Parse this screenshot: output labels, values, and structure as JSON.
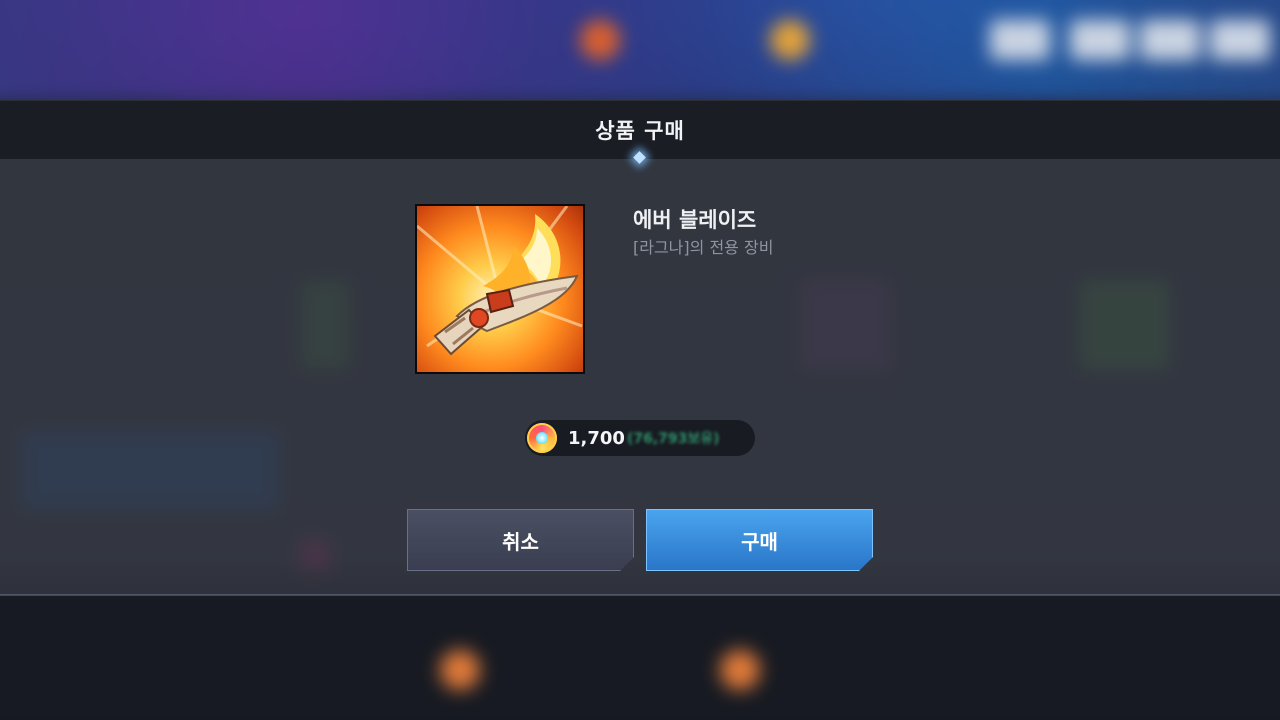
{
  "dialog": {
    "title": "상품 구매"
  },
  "item": {
    "name": "에버 블레이즈",
    "description": "[라그나]의 전용 장비",
    "icon": "flaming-weapon-icon"
  },
  "price": {
    "currency_icon": "gem-currency-icon",
    "amount": "1,700",
    "balance": "(76,793보유)"
  },
  "buttons": {
    "cancel": "취소",
    "buy": "구매"
  },
  "colors": {
    "buy_button": "#3a8fe0",
    "cancel_button": "#42475a",
    "balance_text": "#2f8f6a"
  }
}
